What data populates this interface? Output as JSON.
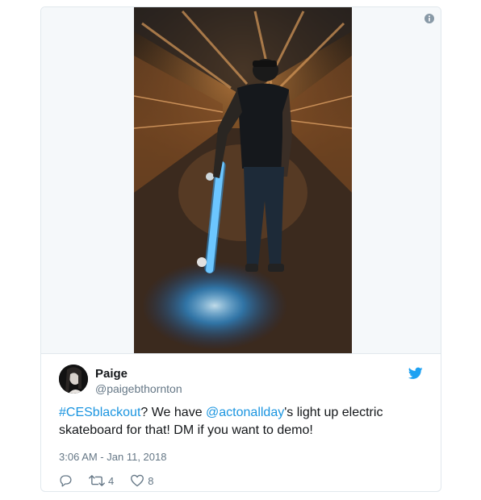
{
  "tweet": {
    "display_name": "Paige",
    "screen_name": "@paigebthornton",
    "text": {
      "hashtag": "#CESblackout",
      "part1": "? We have ",
      "mention": "@actonallday",
      "part2": "'s light up electric skateboard for that! DM if you want to demo!"
    },
    "timestamp": "3:06 AM - Jan 11, 2018",
    "retweets": "4",
    "likes": "8"
  },
  "icons": {
    "info": "info-icon",
    "brand": "twitter-bird-icon",
    "reply": "reply-icon",
    "retweet": "retweet-icon",
    "like": "heart-icon"
  },
  "colors": {
    "link": "#1b95e0",
    "text": "#14171a",
    "muted": "#657786",
    "border": "#e1e8ed"
  }
}
